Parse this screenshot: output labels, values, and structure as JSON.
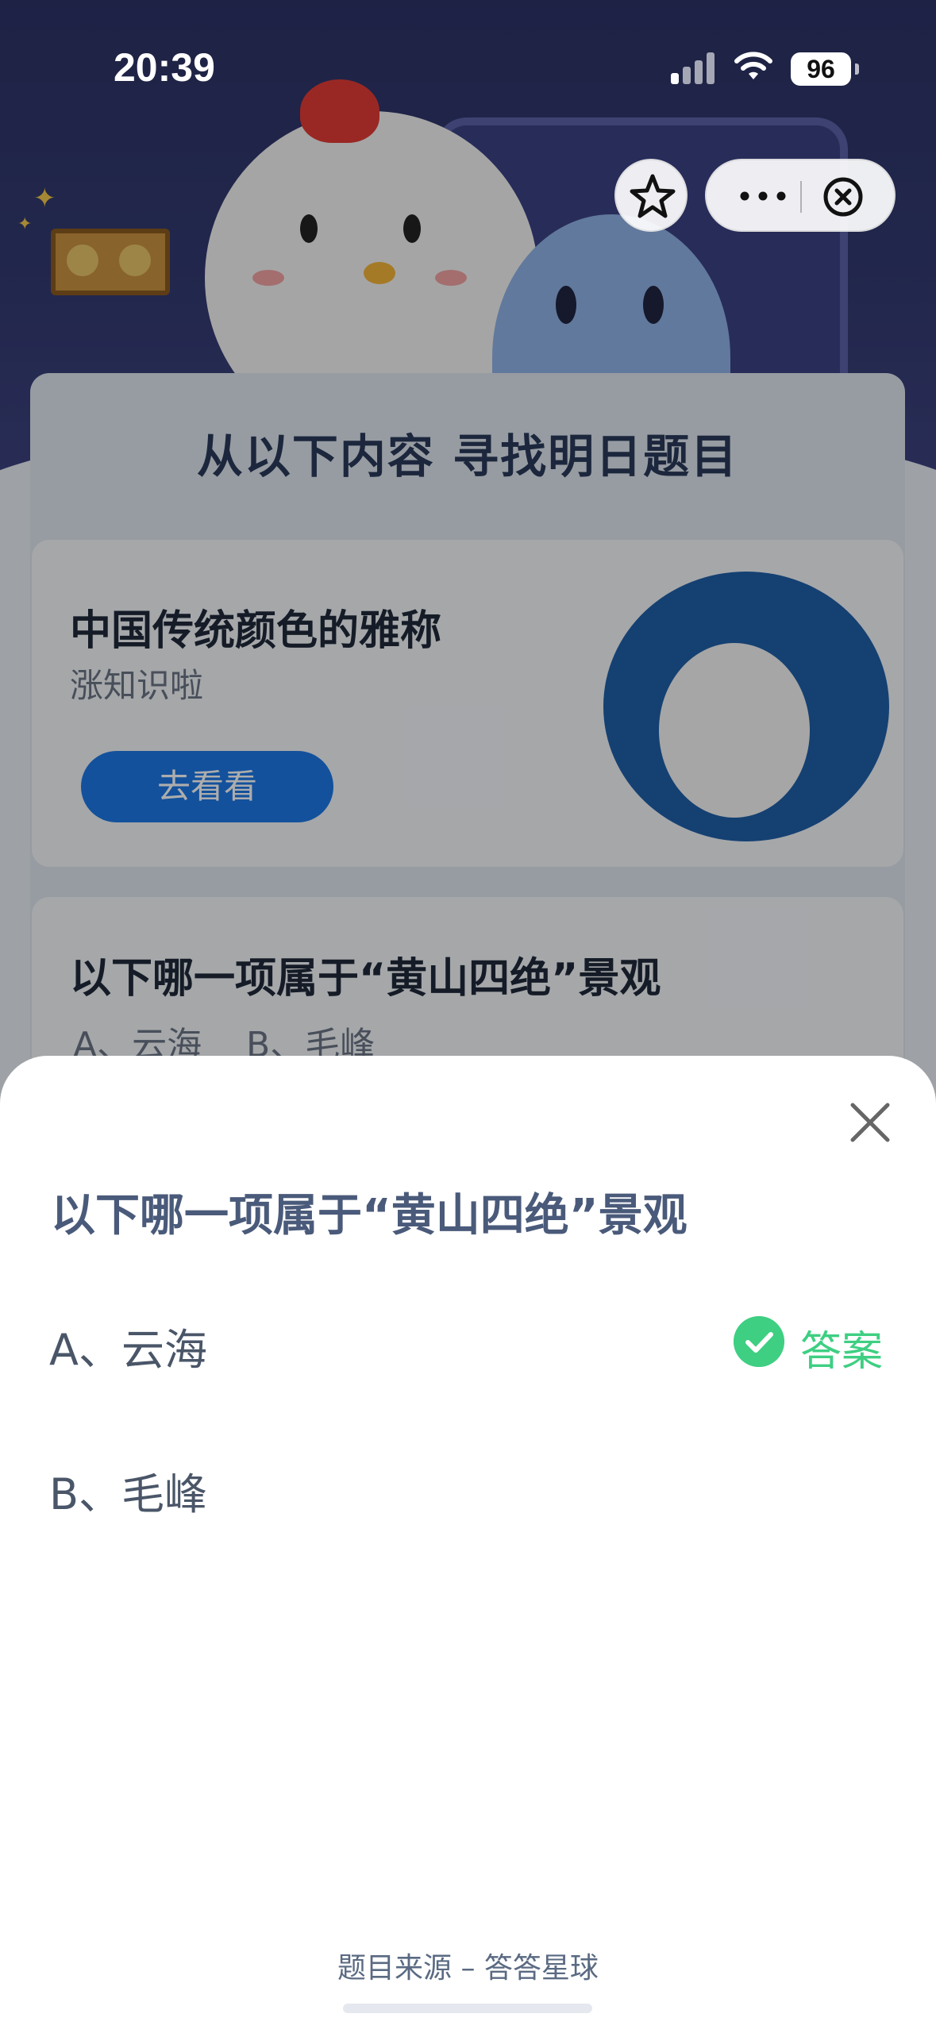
{
  "status_bar": {
    "time": "20:39",
    "battery": "96"
  },
  "capsule": {
    "icons": [
      "star-icon",
      "more-dots-icon",
      "close-circle-icon"
    ]
  },
  "background": {
    "heading": "从以下内容 寻找明日题目",
    "card1": {
      "title": "中国传统颜色的雅称",
      "subtitle": "涨知识啦",
      "button": "去看看"
    },
    "card2": {
      "title": "以下哪一项属于“黄山四绝”景观",
      "options": "A、云海    B、毛峰"
    }
  },
  "sheet": {
    "title": "以下哪一项属于“黄山四绝”景观",
    "options": [
      {
        "label": "A、云海",
        "is_answer": true
      },
      {
        "label": "B、毛峰",
        "is_answer": false
      }
    ],
    "answer_label": "答案",
    "source": "题目来源 – 答答星球"
  },
  "colors": {
    "accent_green": "#3ecf82",
    "title_color": "#4a5a7a",
    "button_blue": "#1d78e6"
  }
}
